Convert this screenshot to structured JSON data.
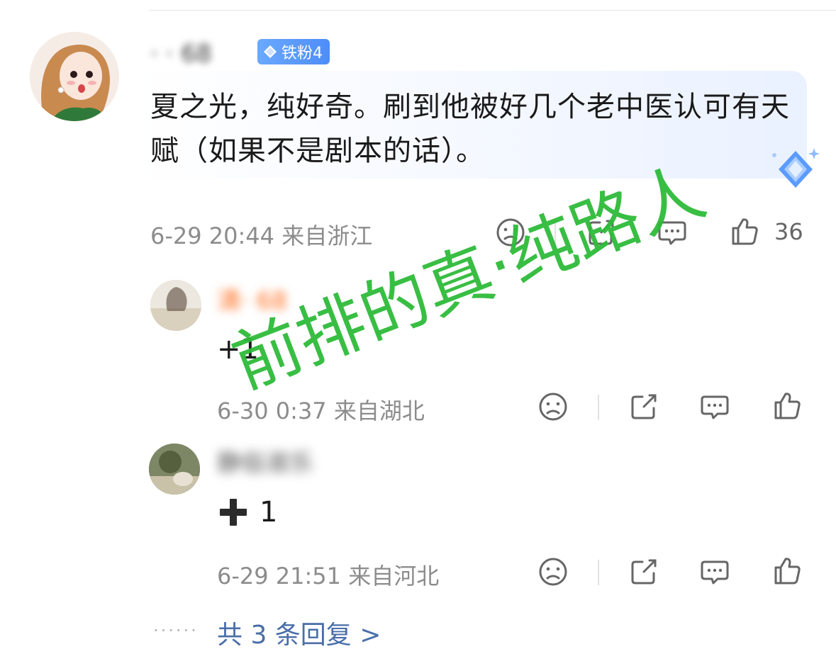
{
  "comment": {
    "username": "· · 68",
    "badge_label": "铁粉4",
    "text": "夏之光，纯好奇。刷到他被好几个老中医认可有天赋（如果不是剧本的话）。",
    "meta": "6-29 20:44  来自浙江",
    "like_count": "36"
  },
  "replies": [
    {
      "username": "清· 68",
      "text": "+1",
      "meta": "6-30 0:37  来自湖北"
    },
    {
      "username": "静俗淑乐",
      "text": "1",
      "meta": "6-29 21:51  来自河北"
    }
  ],
  "more": {
    "dots": "······",
    "link": "共 3 条回复 >"
  },
  "watermark": "前排的真·纯路人",
  "colors": {
    "watermark": "#2fbb3a",
    "badge": "#4e8df7",
    "link": "#4a6ea8",
    "meta": "#8c8c8c"
  },
  "icons": [
    "sad-face-icon",
    "share-icon",
    "comment-icon",
    "thumbs-up-icon",
    "plus-icon",
    "diamond-icon"
  ]
}
